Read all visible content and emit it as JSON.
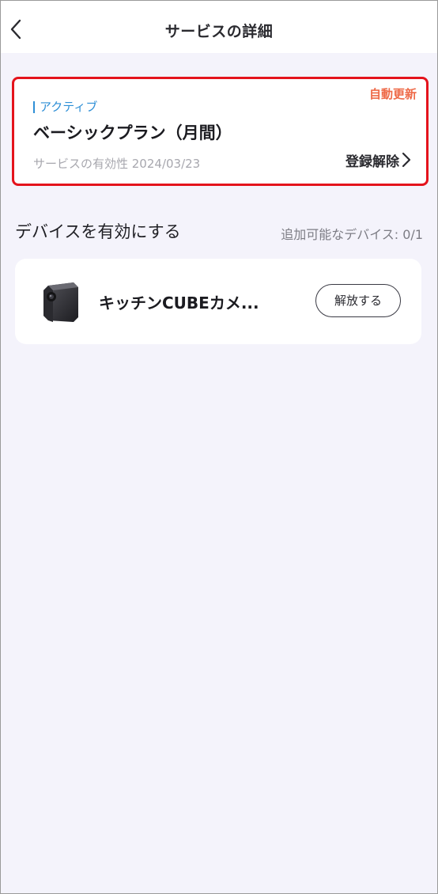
{
  "header": {
    "title": "サービスの詳細",
    "back_icon": "chevron-left-icon"
  },
  "plan": {
    "auto_renew": "自動更新",
    "status": "アクティブ",
    "name": "ベーシックプラン（月間）",
    "validity_label": "サービスの有効性",
    "validity_date": "2024/03/23",
    "validity": "サービスの有効性 2024/03/23",
    "unsubscribe": "登録解除",
    "unsubscribe_icon": "chevron-right-icon",
    "highlight_color": "#e4131c",
    "status_color": "#2e8fd6",
    "auto_renew_color": "#ee6a48"
  },
  "devices": {
    "section_title": "デバイスを有効にする",
    "available_count": "追加可能なデバイス: 0/1",
    "items": [
      {
        "name": "キッチンCUBEカメ...",
        "icon": "cube-camera-icon",
        "action": "解放する"
      }
    ]
  }
}
